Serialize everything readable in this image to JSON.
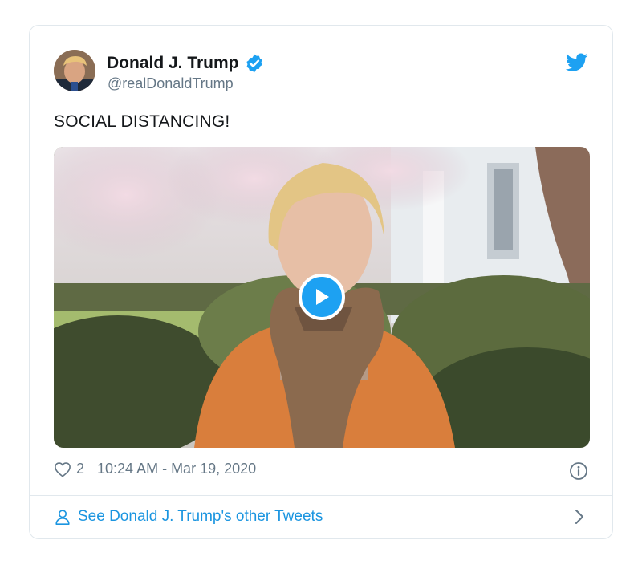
{
  "tweet": {
    "author_name": "Donald J. Trump",
    "author_handle": "@realDonaldTrump",
    "text": "SOCIAL DISTANCING!",
    "like_count": "2",
    "timestamp": "10:24 AM - Mar 19, 2020",
    "footer_link": "See Donald J. Trump's other Tweets"
  },
  "icons": {
    "verified": "verified-badge-icon",
    "brand": "twitter-bird-icon",
    "like": "heart-icon",
    "info": "info-icon",
    "profile": "person-icon",
    "navigate": "chevron-right-icon",
    "media_play": "play-icon"
  },
  "colors": {
    "accent": "#1da1f2",
    "link": "#1b95e0",
    "secondary_text": "#657786",
    "border": "#e1e8ed"
  }
}
